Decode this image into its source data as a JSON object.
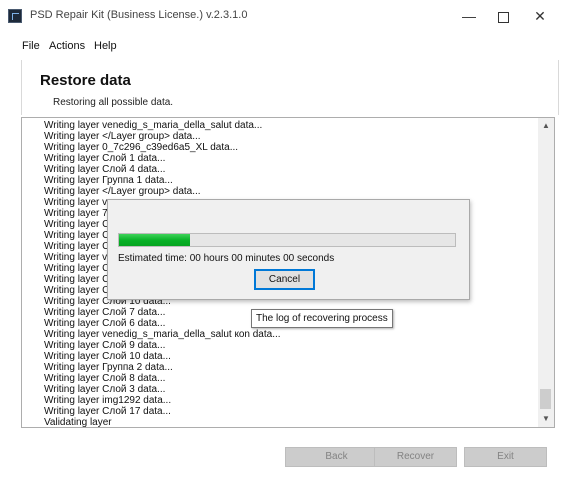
{
  "window": {
    "title": "PSD Repair Kit (Business License.) v.2.3.1.0",
    "controls": {
      "minimize": "—",
      "close": "✕"
    }
  },
  "menu": [
    "File",
    "Actions",
    "Help"
  ],
  "header": {
    "title": "Restore data",
    "subtitle": "Restoring all possible data."
  },
  "log": {
    "lines": [
      "Writing layer venedig_s_maria_della_salut data...",
      "Writing layer </Layer group> data...",
      "Writing layer 0_7c296_c39ed6a5_XL data...",
      "Writing layer Слой 1 data...",
      "Writing layer Слой 4 data...",
      "Writing layer Группа 1 data...",
      "Writing layer </Layer group> data...",
      "Writing layer ve",
      "Writing layer 7(",
      "Writing layer C",
      "Writing layer C",
      "Writing layer C",
      "Writing layer ve",
      "Writing layer C",
      "Writing layer C",
      "Writing layer C",
      "Writing layer Слой 10 data...",
      "Writing layer Слой 7 data...",
      "Writing layer Слой 6 data...",
      "Writing layer venedig_s_maria_della_salut кon data...",
      "Writing layer Слой 9 data...",
      "Writing layer Слой 10 data...",
      "Writing layer Группа 2 data...",
      "Writing layer Слой 8 data...",
      "Writing layer Слой 3 data...",
      "Writing layer img1292 data...",
      "Writing layer Слой 17 data...",
      "Validating layer"
    ],
    "scroll": {
      "up": "▲",
      "down": "▼"
    }
  },
  "progress_dialog": {
    "progress_fraction": 0.21,
    "estimated_time": "Estimated time: 00 hours 00 minutes 00 seconds",
    "cancel_label": "Cancel",
    "fill_color": "#06b025"
  },
  "tooltip": {
    "text": "The log of recovering process"
  },
  "footer": {
    "back": "Back",
    "recover": "Recover",
    "exit": "Exit"
  }
}
